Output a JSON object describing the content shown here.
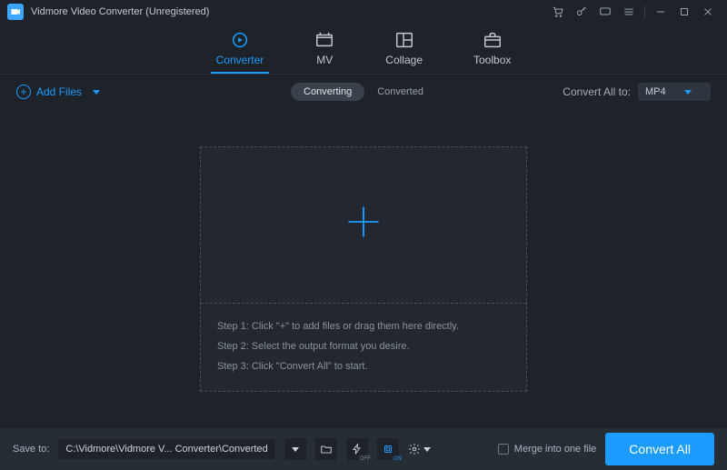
{
  "window": {
    "title": "Vidmore Video Converter (Unregistered)"
  },
  "tabs": {
    "converter": "Converter",
    "mv": "MV",
    "collage": "Collage",
    "toolbox": "Toolbox"
  },
  "toolbar": {
    "add_files_label": "Add Files",
    "seg_converting": "Converting",
    "seg_converted": "Converted",
    "convert_all_to_label": "Convert All to:",
    "convert_all_to_value": "MP4"
  },
  "dropzone": {
    "step1": "Step 1: Click \"+\" to add files or drag them here directly.",
    "step2": "Step 2: Select the output format you desire.",
    "step3": "Step 3: Click \"Convert All\" to start."
  },
  "footer": {
    "save_to_label": "Save to:",
    "save_to_path": "C:\\Vidmore\\Vidmore V... Converter\\Converted",
    "merge_label": "Merge into one file",
    "convert_all_button": "Convert All"
  },
  "icons": {
    "hw_off_badge": "OFF",
    "hs_on_badge": "ON"
  }
}
